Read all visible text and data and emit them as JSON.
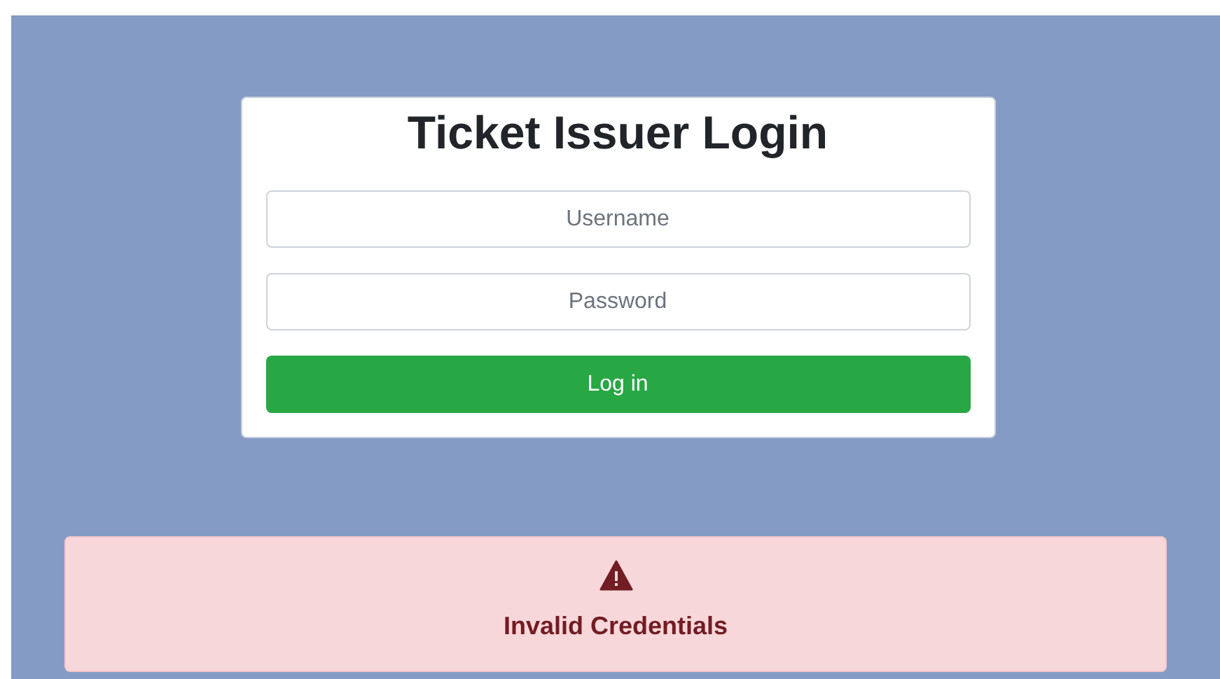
{
  "login_card": {
    "title": "Ticket Issuer Login",
    "fields": [
      {
        "placeholder": "Username"
      },
      {
        "placeholder": "Password"
      }
    ],
    "submit_button": "Log in"
  },
  "alert": {
    "kind": "error",
    "message": "Invalid Credentials"
  }
}
